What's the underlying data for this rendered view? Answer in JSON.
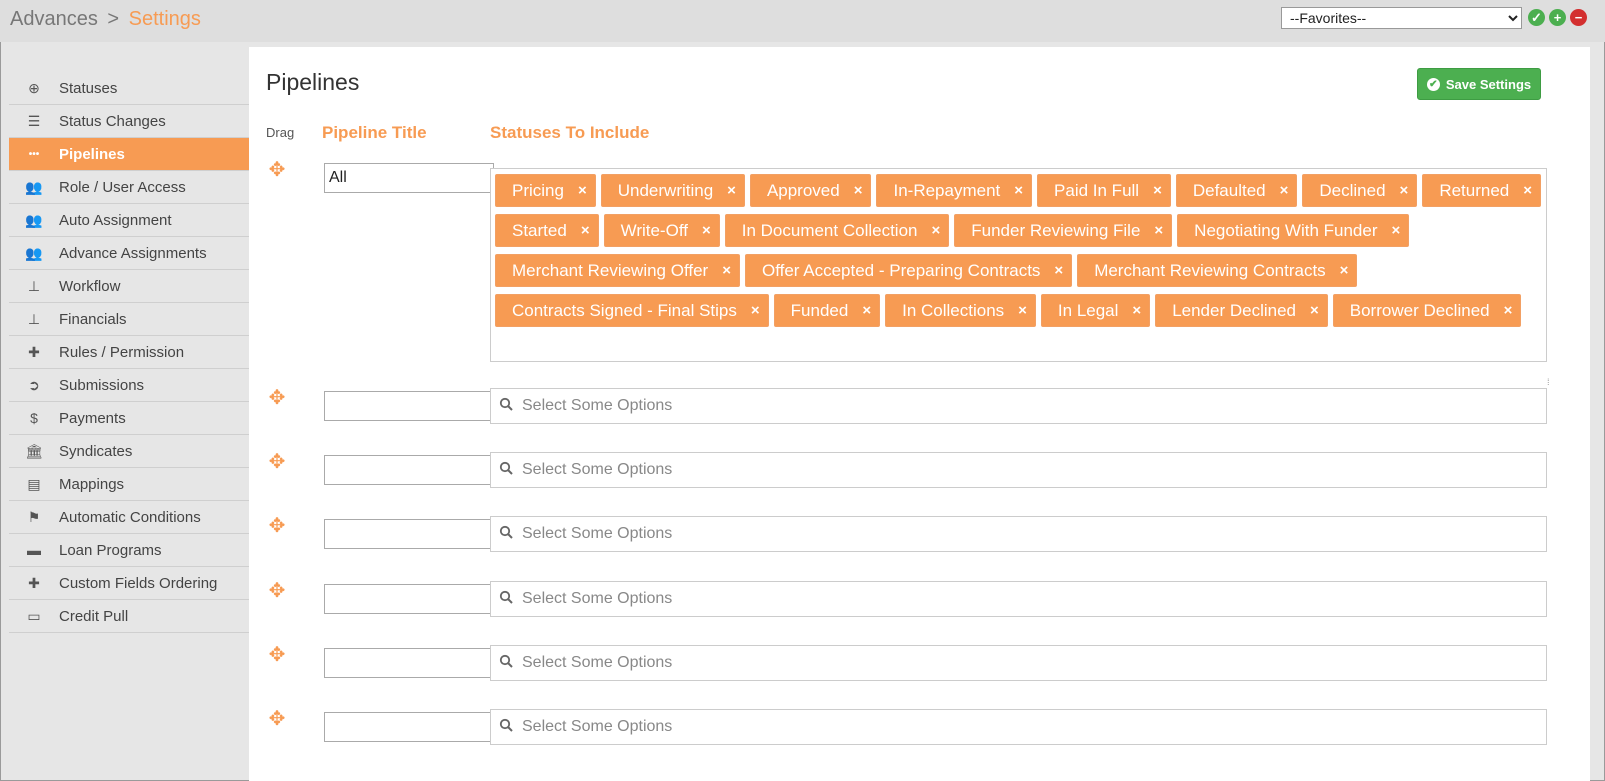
{
  "header": {
    "breadcrumb_root": "Advances",
    "breadcrumb_sep": ">",
    "breadcrumb_current": "Settings",
    "favorites_selected": "--Favorites--",
    "accent_color": "#f79b53"
  },
  "sidebar": {
    "items": [
      {
        "label": "Statuses",
        "icon": "plus-circle-icon"
      },
      {
        "label": "Status Changes",
        "icon": "bars-icon"
      },
      {
        "label": "Pipelines",
        "icon": "ellipsis-icon",
        "active": true
      },
      {
        "label": "Role / User Access",
        "icon": "users-icon"
      },
      {
        "label": "Auto Assignment",
        "icon": "users-icon"
      },
      {
        "label": "Advance Assignments",
        "icon": "users-icon"
      },
      {
        "label": "Workflow",
        "icon": "sitemap-icon"
      },
      {
        "label": "Financials",
        "icon": "sitemap-icon"
      },
      {
        "label": "Rules / Permission",
        "icon": "puzzle-icon"
      },
      {
        "label": "Submissions",
        "icon": "arrow-circle-icon"
      },
      {
        "label": "Payments",
        "icon": "dollar-icon"
      },
      {
        "label": "Syndicates",
        "icon": "bank-icon"
      },
      {
        "label": "Mappings",
        "icon": "file-icon"
      },
      {
        "label": "Automatic Conditions",
        "icon": "flag-icon"
      },
      {
        "label": "Loan Programs",
        "icon": "briefcase-icon"
      },
      {
        "label": "Custom Fields Ordering",
        "icon": "puzzle-icon"
      },
      {
        "label": "Credit Pull",
        "icon": "credit-card-icon"
      }
    ]
  },
  "main": {
    "title": "Pipelines",
    "save_label": "Save Settings",
    "columns": {
      "drag": "Drag",
      "title": "Pipeline Title",
      "statuses": "Statuses To Include"
    },
    "pipelines": [
      {
        "title": "All",
        "statuses": [
          "Pricing",
          "Underwriting",
          "Approved",
          "In-Repayment",
          "Paid In Full",
          "Defaulted",
          "Declined",
          "Returned",
          "Started",
          "Write-Off",
          "In Document Collection",
          "Funder Reviewing File",
          "Negotiating With Funder",
          "Merchant Reviewing Offer",
          "Offer Accepted - Preparing Contracts",
          "Merchant Reviewing Contracts",
          "Contracts Signed - Final Stips",
          "Funded",
          "In Collections",
          "In Legal",
          "Lender Declined",
          "Borrower Declined"
        ]
      },
      {
        "title": "",
        "placeholder": "Select Some Options"
      },
      {
        "title": "",
        "placeholder": "Select Some Options"
      },
      {
        "title": "",
        "placeholder": "Select Some Options"
      },
      {
        "title": "",
        "placeholder": "Select Some Options"
      },
      {
        "title": "",
        "placeholder": "Select Some Options"
      },
      {
        "title": "",
        "placeholder": "Select Some Options"
      }
    ]
  }
}
